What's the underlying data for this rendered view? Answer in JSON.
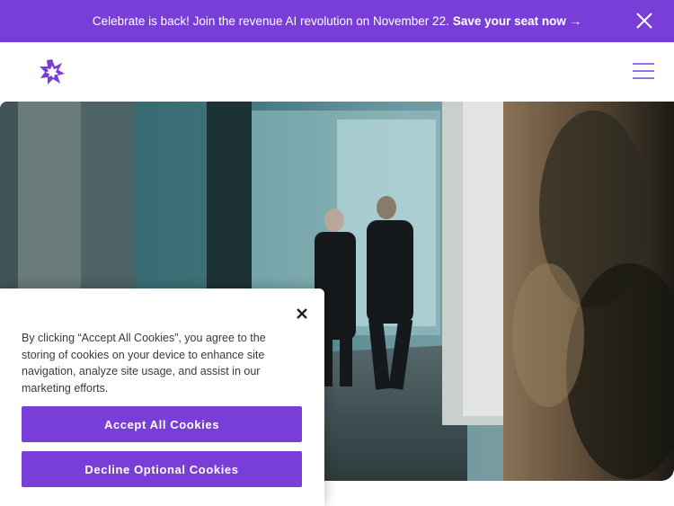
{
  "announcement": {
    "message": "Celebrate is back! Join the revenue AI revolution on November 22.",
    "cta": "Save your seat now →",
    "close_icon": "close-icon"
  },
  "header": {
    "logo_icon": "starburst-logo-icon",
    "menu_icon": "hamburger-menu-icon"
  },
  "hero": {
    "image": "office-hallway-two-men-walking-photo"
  },
  "cookie_banner": {
    "close_icon": "close-icon",
    "text": "By clicking “Accept All Cookies”, you agree to the storing of cookies on your device to enhance site navigation, analyze site usage, and assist in our marketing efforts.",
    "accept_label": "Accept All Cookies",
    "decline_label": "Decline Optional Cookies"
  },
  "colors": {
    "brand_purple": "#7a3ed8",
    "text": "#3a3a3a"
  }
}
